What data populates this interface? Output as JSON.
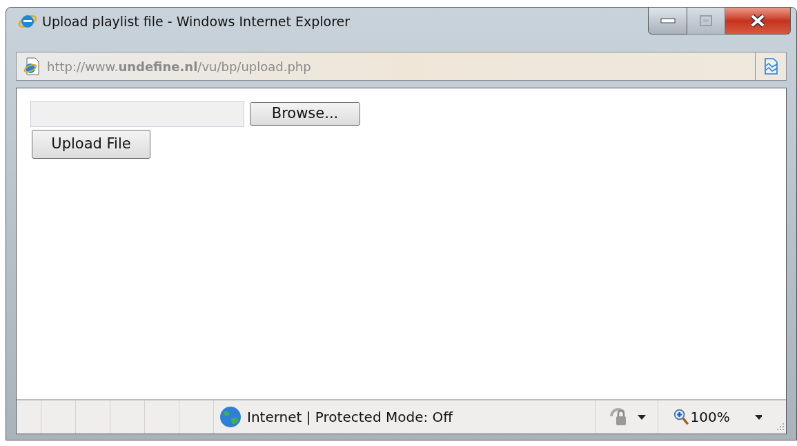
{
  "window": {
    "title": "Upload playlist file - Windows Internet Explorer"
  },
  "address_bar": {
    "url": "http://www.**undefine.nl**/vu/bp/upload.php"
  },
  "form": {
    "browse_button": "Browse...",
    "upload_button": "Upload File"
  },
  "status_bar": {
    "zone": "Internet | Protected Mode: Off",
    "zoom": "100%"
  }
}
